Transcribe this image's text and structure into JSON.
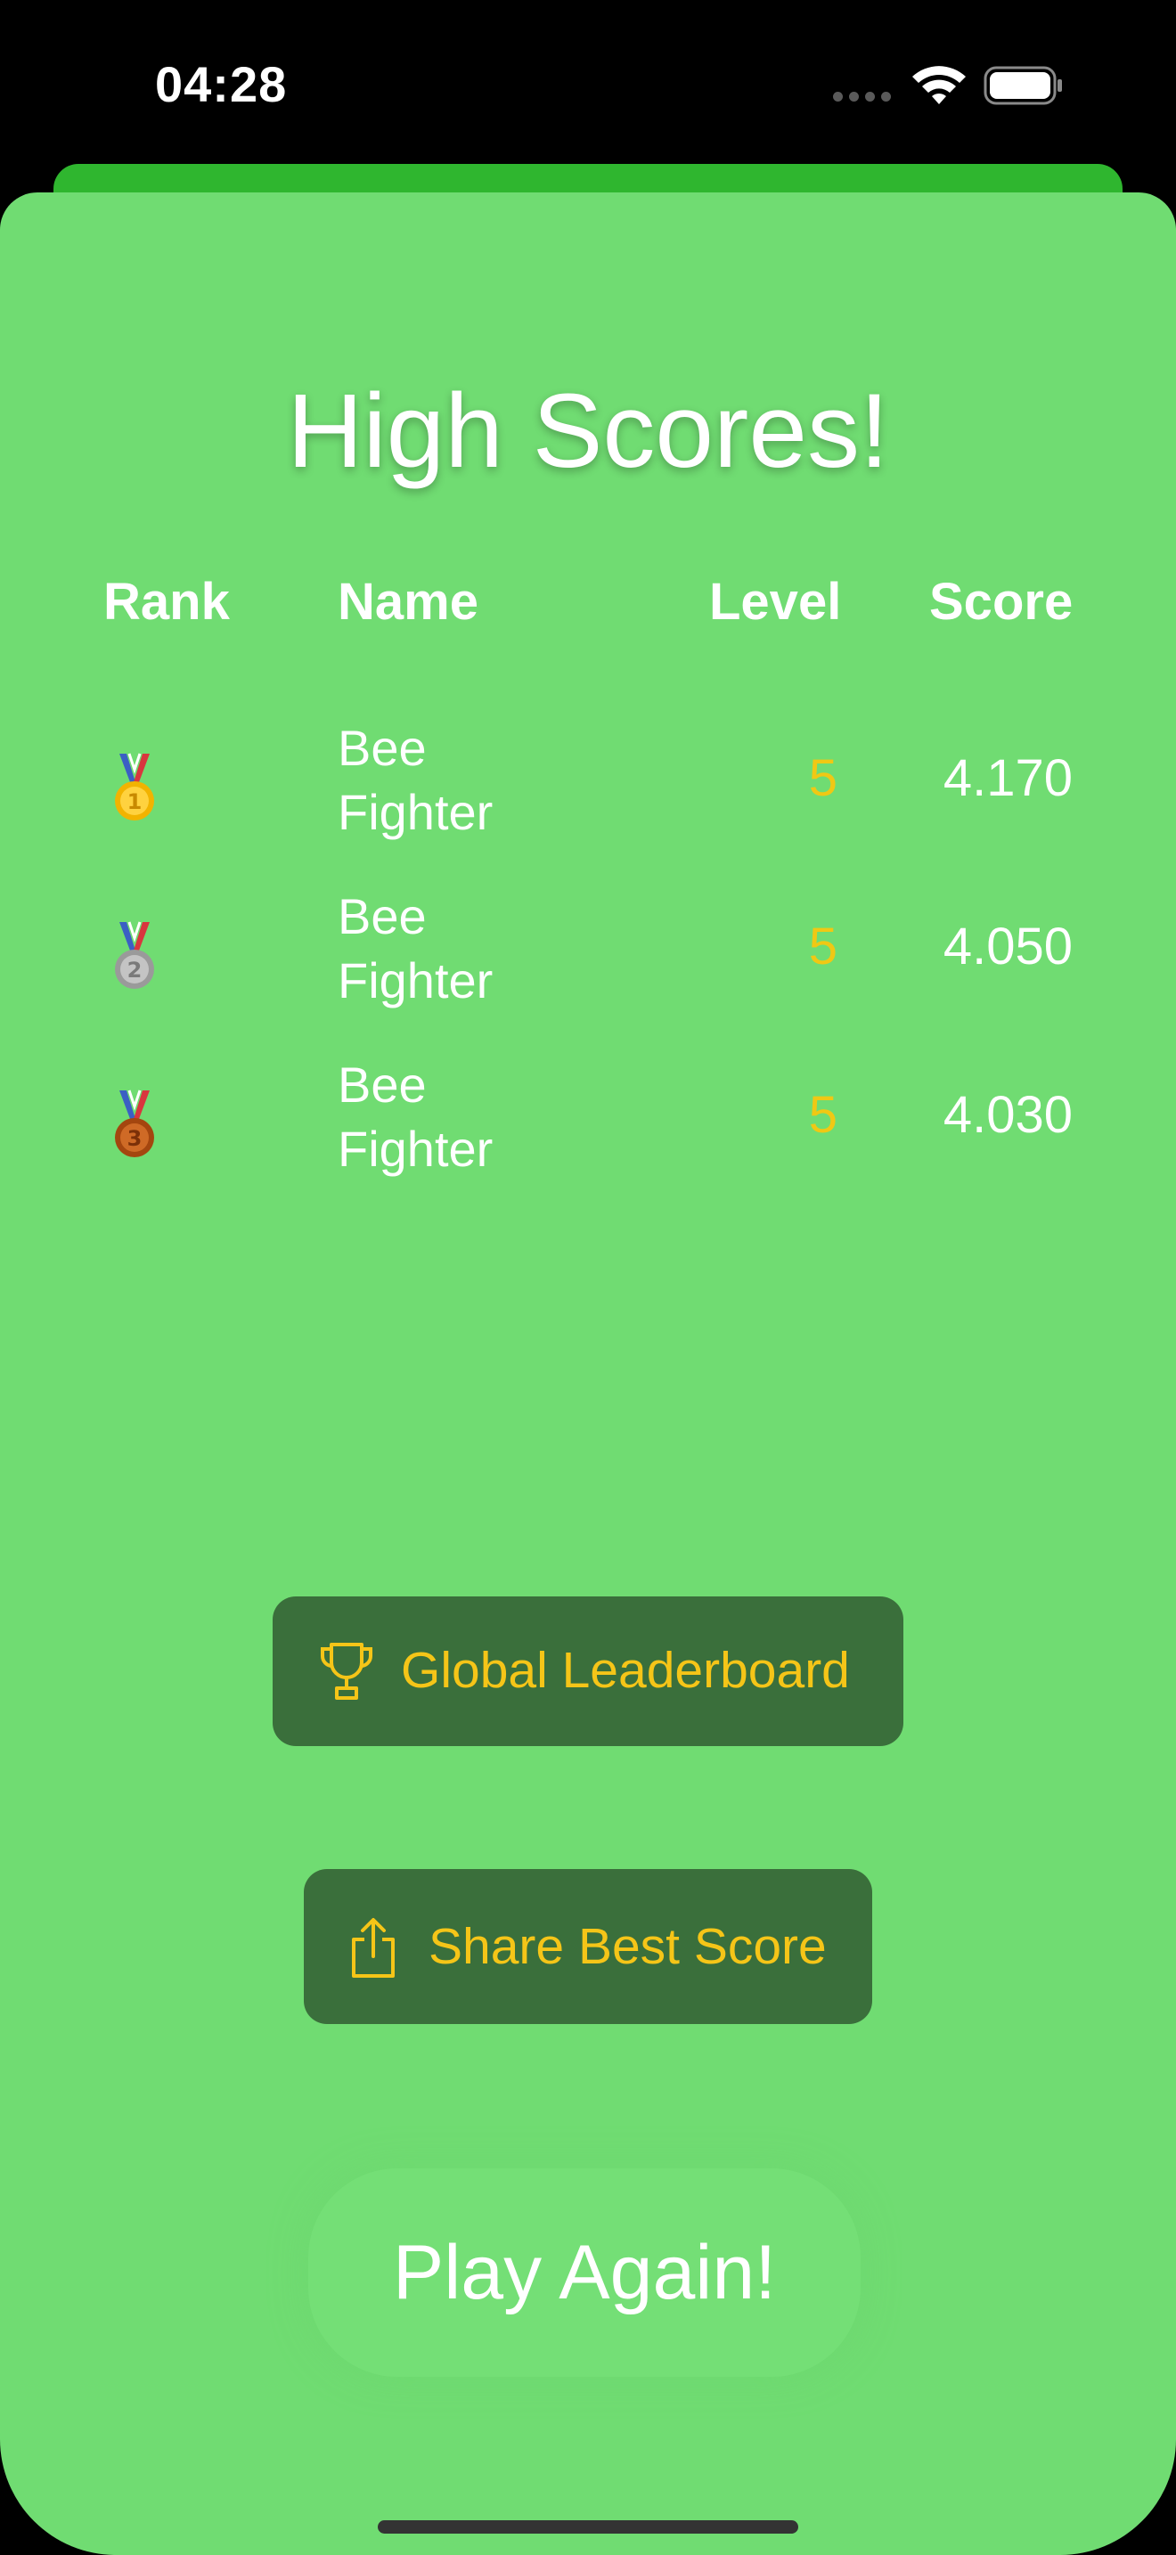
{
  "status_bar": {
    "time": "04:28",
    "icons": [
      "cellular-signal-icon",
      "wifi-icon",
      "battery-icon"
    ]
  },
  "screen": {
    "title": "High Scores!",
    "columns": {
      "rank": "Rank",
      "name": "Name",
      "level": "Level",
      "score": "Score"
    },
    "rows": [
      {
        "rank_icon": "gold-medal-icon",
        "medal_number": "1",
        "name_line1": "Bee",
        "name_line2": "Fighter",
        "level": "5",
        "score": "4.170"
      },
      {
        "rank_icon": "silver-medal-icon",
        "medal_number": "2",
        "name_line1": "Bee",
        "name_line2": "Fighter",
        "level": "5",
        "score": "4.050"
      },
      {
        "rank_icon": "bronze-medal-icon",
        "medal_number": "3",
        "name_line1": "Bee",
        "name_line2": "Fighter",
        "level": "5",
        "score": "4.030"
      }
    ],
    "buttons": {
      "leaderboard": {
        "label": "Global Leaderboard",
        "icon": "trophy-icon"
      },
      "share": {
        "label": "Share Best Score",
        "icon": "share-icon"
      },
      "play_again": {
        "label": "Play Again!"
      }
    }
  },
  "colors": {
    "background": "#70dc72",
    "header_strip": "#2fb62f",
    "button_bg": "#3a6f3b",
    "accent_yellow": "#f5c518",
    "text": "#ffffff"
  }
}
